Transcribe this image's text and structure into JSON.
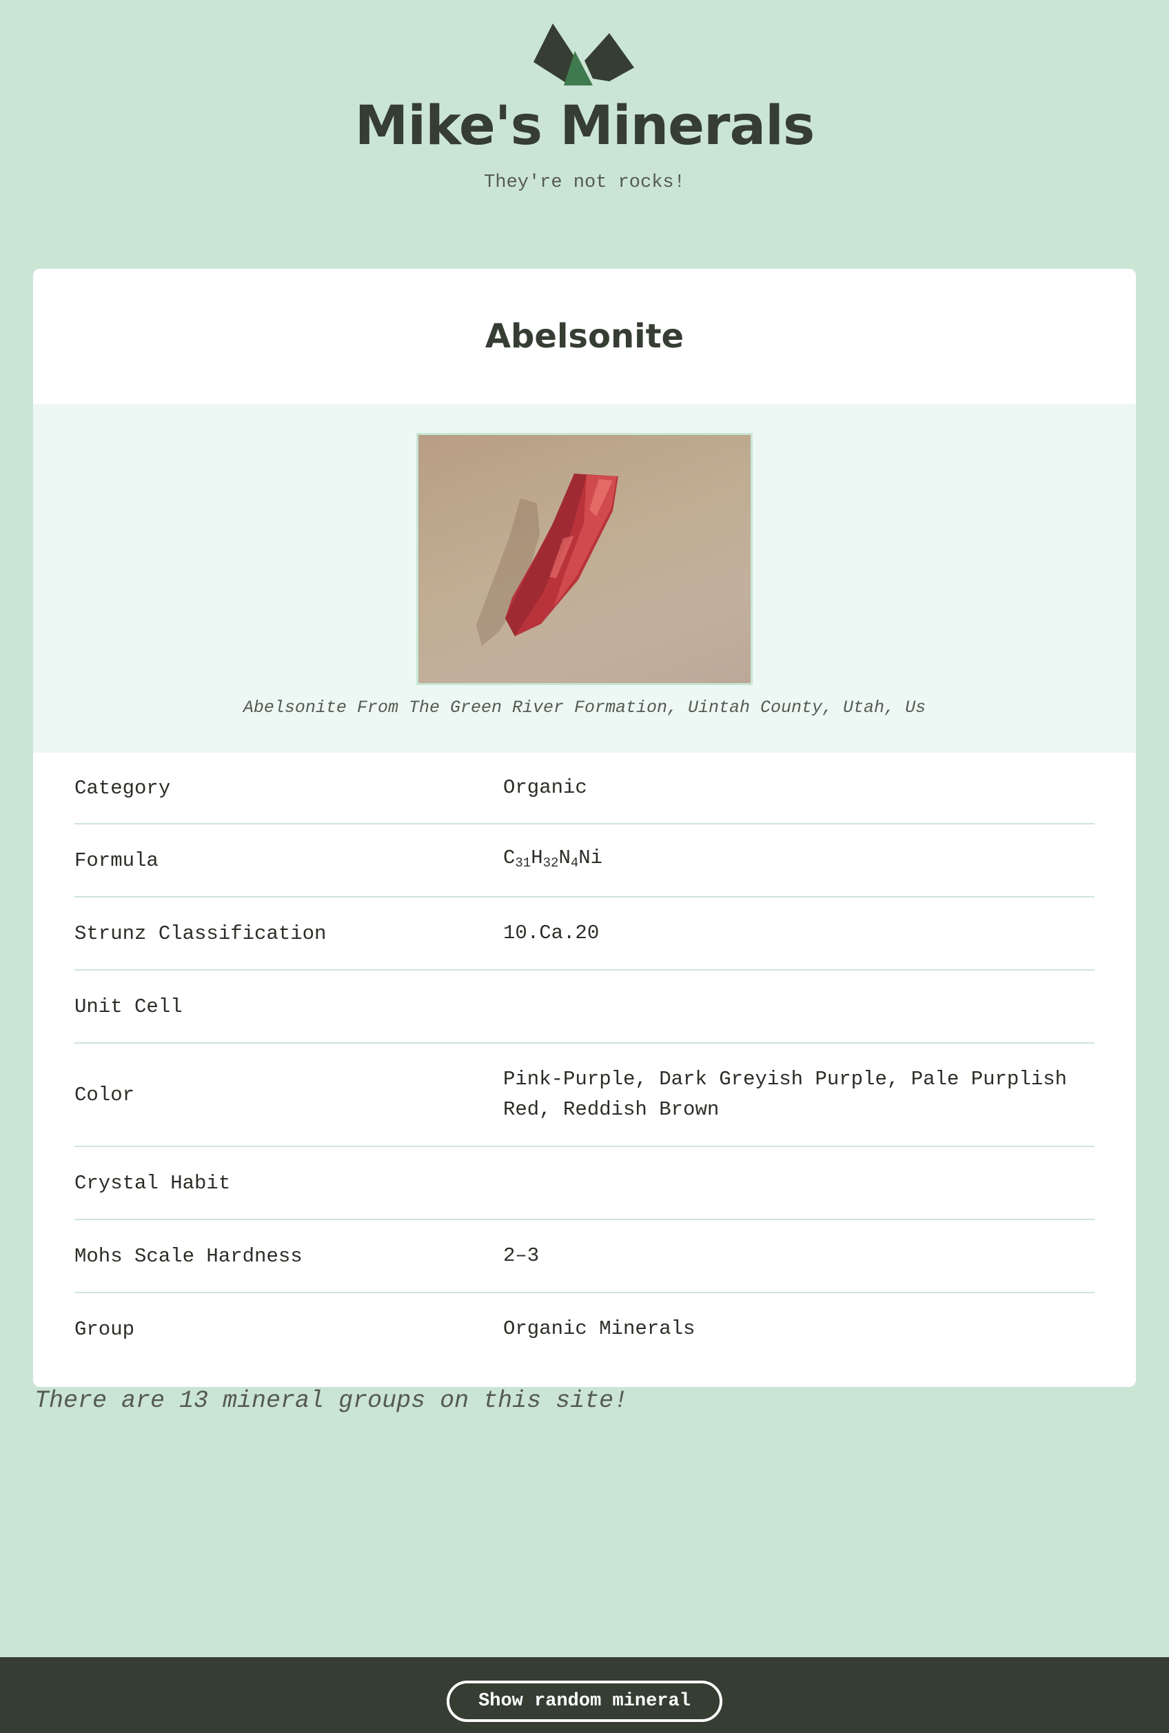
{
  "site": {
    "title": "Mike's Minerals",
    "tagline": "They're not rocks!",
    "logo_icon": "mountain-crystals-logo"
  },
  "mineral": {
    "name": "Abelsonite",
    "image_caption": "Abelsonite From The Green River Formation, Uintah County, Utah, Us",
    "properties": [
      {
        "label": "Category",
        "value": "Organic"
      },
      {
        "label": "Formula",
        "value": "C31H32N4Ni"
      },
      {
        "label": "Strunz Classification",
        "value": "10.Ca.20"
      },
      {
        "label": "Unit Cell",
        "value": ""
      },
      {
        "label": "Color",
        "value": "Pink-Purple, Dark Greyish Purple, Pale Purplish Red, Reddish Brown"
      },
      {
        "label": "Crystal Habit",
        "value": ""
      },
      {
        "label": "Mohs Scale Hardness",
        "value": "2–3"
      },
      {
        "label": "Group",
        "value": "Organic Minerals"
      }
    ],
    "formula_parts": [
      {
        "text": "C",
        "sub": "31"
      },
      {
        "text": "H",
        "sub": "32"
      },
      {
        "text": "N",
        "sub": "4"
      },
      {
        "text": "Ni",
        "sub": ""
      }
    ]
  },
  "note": "There are 13 mineral groups on this site!",
  "footer": {
    "button_label": "Show random mineral"
  },
  "colors": {
    "background": "#cbe5d4",
    "dark": "#363d32",
    "accent_green": "#3f7a4f",
    "figure_bg": "#edf8f4"
  }
}
